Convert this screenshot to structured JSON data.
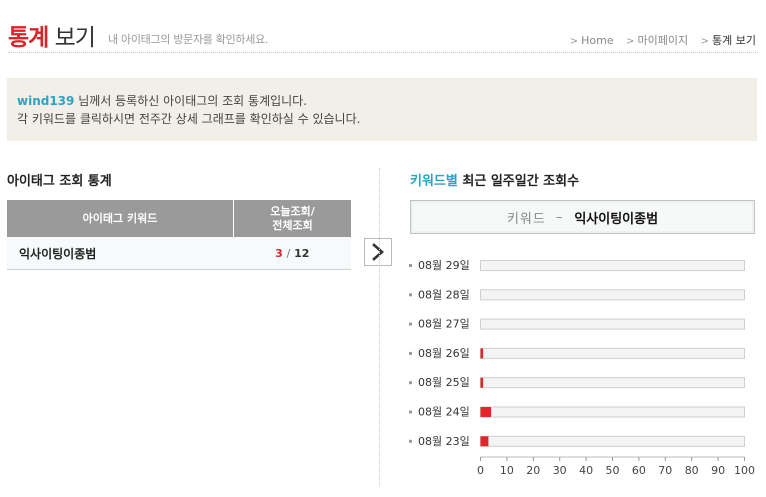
{
  "header": {
    "title_part1": "통계",
    "title_part2": "보기",
    "description": "내 아이태그의 방문자를 확인하세요.",
    "breadcrumb": [
      "Home",
      "마이페이지",
      "통계 보기"
    ]
  },
  "info": {
    "user_id": "wind139",
    "line1_suffix": " 님께서 등록하신 아이태그의 조회 통계입니다.",
    "line2": "각 키워드를 클릭하시면 전주간 상세 그래프를 확인하실 수 있습니다."
  },
  "left_panel": {
    "title": "아이태그 조회 통계",
    "table": {
      "col_keyword": "아이태그 키워드",
      "col_views_line1": "오늘조회/",
      "col_views_line2": "전체조회",
      "rows": [
        {
          "keyword": "익사이팅이종범",
          "today": "3",
          "sep": "/",
          "total": "12"
        }
      ]
    }
  },
  "right_panel": {
    "title_highlight": "키워드별",
    "title_rest": " 최근 일주일간 조회수",
    "keyword_label": "키워드",
    "keyword_dash": "–",
    "keyword_value": "익사이팅이종범"
  },
  "icons": {
    "arrow_button": "chevron-right-icon"
  },
  "colors": {
    "accent_red": "#d7262b",
    "accent_blue": "#2ba3c1",
    "bar_fill": "#e0262b"
  },
  "chart_data": {
    "type": "bar",
    "orientation": "horizontal",
    "categories": [
      "08월 29일",
      "08월 28일",
      "08월 27일",
      "08월 26일",
      "08월 25일",
      "08월 24일",
      "08월 23일"
    ],
    "values": [
      0,
      0,
      0,
      1,
      1,
      4,
      3
    ],
    "xlim": [
      0,
      100
    ],
    "xticks": [
      0,
      10,
      20,
      30,
      40,
      50,
      60,
      70,
      80,
      90,
      100
    ],
    "grid": false,
    "legend": "none"
  }
}
